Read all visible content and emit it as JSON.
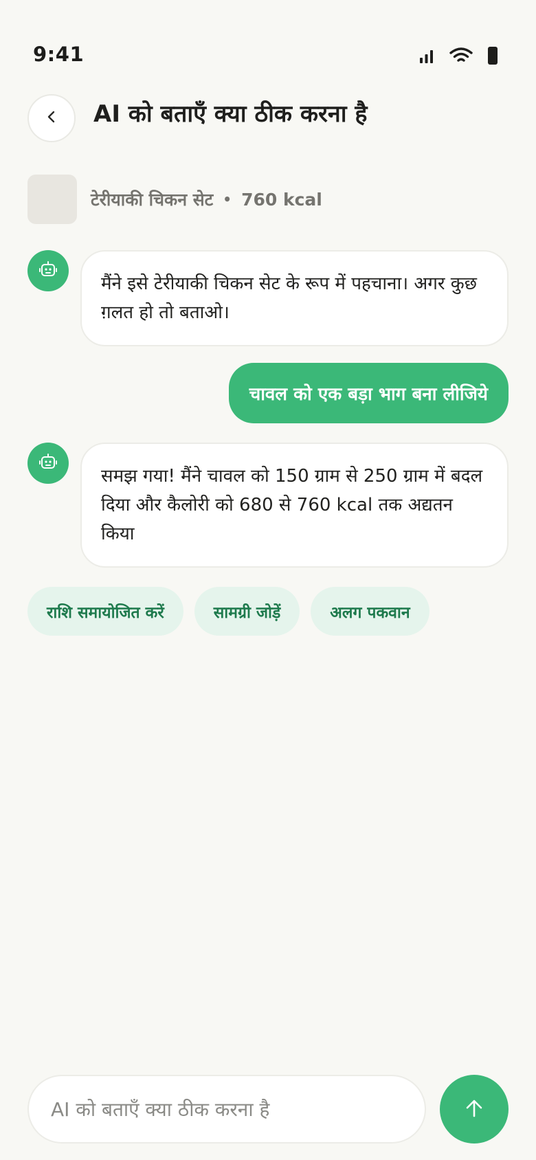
{
  "status_bar": {
    "time": "9:41",
    "icons": [
      "signal-icon",
      "wifi-icon",
      "battery-icon"
    ]
  },
  "header": {
    "back_icon": "chevron-left-icon",
    "title": "AI को बताएँ क्या ठीक करना है"
  },
  "food": {
    "name": "टेरीयाकी चिकन सेट",
    "separator": "•",
    "calories": "760 kcal"
  },
  "messages": [
    {
      "role": "bot",
      "avatar_icon": "robot-icon",
      "text": "मैंने इसे टेरीयाकी चिकन सेट के रूप में पहचाना। अगर कुछ ग़लत हो तो बताओ।"
    },
    {
      "role": "user",
      "text": "चावल को एक बड़ा भाग बना लीजिये"
    },
    {
      "role": "bot",
      "avatar_icon": "robot-icon",
      "text": "समझ गया! मैंने चावल को 150 ग्राम से 250 ग्राम में बदल दिया और कैलोरी को 680 से 760 kcal तक अद्यतन किया"
    }
  ],
  "suggestions": [
    "राशि समायोजित करें",
    "सामग्री जोड़ें",
    "अलग पकवान"
  ],
  "composer": {
    "placeholder": "AI को बताएँ क्या ठीक करना है",
    "value": "",
    "send_icon": "arrow-up-icon"
  },
  "colors": {
    "accent": "#3bb878",
    "chip_bg": "#e5f4ec",
    "chip_text": "#1e7a4d",
    "background": "#f8f8f4"
  }
}
